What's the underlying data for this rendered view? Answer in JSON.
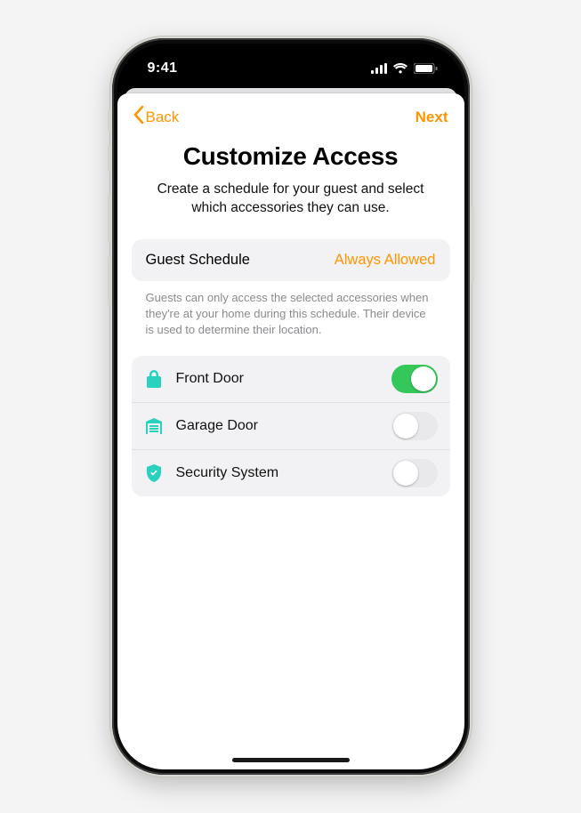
{
  "status": {
    "time": "9:41"
  },
  "nav": {
    "back_label": "Back",
    "next_label": "Next"
  },
  "header": {
    "title": "Customize Access",
    "subtitle": "Create a schedule for your guest and select which accessories they can use."
  },
  "schedule": {
    "label": "Guest Schedule",
    "value": "Always Allowed",
    "note": "Guests can only access the selected accessories when they're at your home during this schedule. Their device is used to determine their location."
  },
  "accessories": [
    {
      "icon": "lock-icon",
      "label": "Front Door",
      "on": true
    },
    {
      "icon": "garage-icon",
      "label": "Garage Door",
      "on": false
    },
    {
      "icon": "shield-icon",
      "label": "Security System",
      "on": false
    }
  ]
}
